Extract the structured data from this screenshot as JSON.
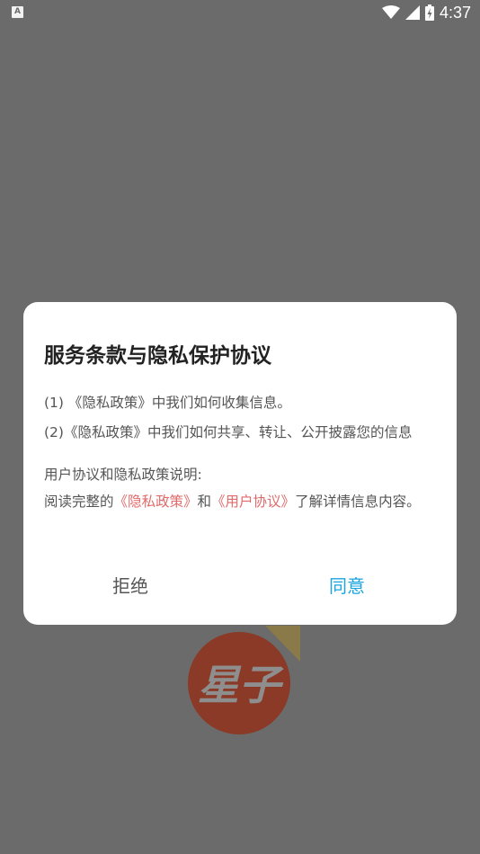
{
  "status_bar": {
    "notification_glyph": "A",
    "time": "4:37"
  },
  "splash": {
    "logo_text": "星子"
  },
  "dialog": {
    "title": "服务条款与隐私保护协议",
    "line1": "(1) 《隐私政策》中我们如何收集信息。",
    "line2": "(2)《隐私政策》中我们如何共享、转让、公开披露您的信息",
    "line3": "用户协议和隐私政策说明:",
    "line4_prefix": "阅读完整的",
    "line4_privacy_link": "《隐私政策》",
    "line4_and": "和",
    "line4_user_link": "《用户协议》",
    "line4_suffix": "了解详情信息内容。",
    "reject_label": "拒绝",
    "agree_label": "同意"
  },
  "colors": {
    "overlay": "#6b6b6b",
    "link": "#e26a6a",
    "agree": "#1ba4dd"
  }
}
